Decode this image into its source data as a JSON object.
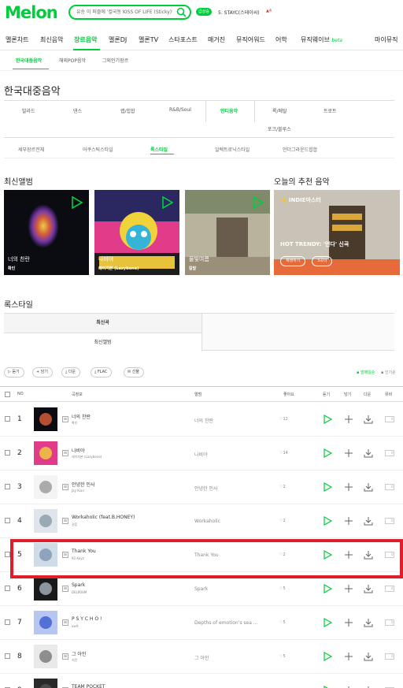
{
  "header": {
    "logo": "Melon",
    "search_text": "유승 이 퍼즐에 '컬국동 KISS OF LIFE (Sticky)'",
    "realtime_badge": "급상승",
    "realtime_text": "5. STAYC(스테이씨)",
    "realtime_change": "▲4"
  },
  "gnb": {
    "items": [
      "멜론차트",
      "최신음악",
      "장르음악",
      "멜론DJ",
      "멜론TV",
      "스타포스트",
      "매거진",
      "뮤직어워드",
      "어학",
      "뮤직웨이브",
      "마이뮤직"
    ],
    "beta": "beta"
  },
  "sub_gnb": [
    "한국대중음악",
    "해외POP음악",
    "그외인기장르"
  ],
  "page_title": "한국대중음악",
  "genres": {
    "row1": [
      "발라드",
      "댄스",
      "랩/힙합",
      "R&B/Soul",
      "인디음악",
      "록/메탈",
      "트로트"
    ],
    "row2": [
      "포크/블루스"
    ]
  },
  "style_tabs": [
    "세부장르전체",
    "어쿠스틱스타일",
    "록스타일",
    "일렉트로닉스타일",
    "언더그라운드힙합"
  ],
  "sections": {
    "new_albums": "최신앨범",
    "recommend": "오늘의 추천 음악",
    "rock_style": "록스타일"
  },
  "albums": [
    {
      "name": "너의 찬란",
      "artist": "확인"
    },
    {
      "name": "나비야",
      "artist": "레이지본 (Lazybone)"
    },
    {
      "name": "물빛여름",
      "artist": "칼말"
    }
  ],
  "recommend": {
    "badge_dj": "DJ",
    "badge_text": "INDIE마스터",
    "title": "HOT TRENDY: '언다' 신곡",
    "btn1": "재생하기",
    "btn2": "3곡더"
  },
  "sub_tabs": [
    "최신곡",
    "최신앨범"
  ],
  "toolbar": {
    "buttons": [
      "듣기",
      "담기",
      "다운",
      "FLAC",
      "선물"
    ],
    "sort_active": "▪ 발매일순",
    "sort_other": "▪ 인기순"
  },
  "table_headers": {
    "no": "NO",
    "song": "곡정보",
    "album": "앨범",
    "like": "좋아요",
    "listen": "듣기",
    "add": "담기",
    "download": "다운",
    "mv": "뮤비"
  },
  "rows": [
    {
      "rank": "1",
      "title": "너의 찬란",
      "artist": "확인",
      "album": "너의 찬란",
      "likes": "12"
    },
    {
      "rank": "2",
      "title": "나비야",
      "artist": "레이지본 (Lazybone)",
      "album": "나비야",
      "likes": "14"
    },
    {
      "rank": "3",
      "title": "안녕한 인사",
      "artist": "Jay Kiair",
      "album": "안녕한 인사",
      "likes": "2"
    },
    {
      "rank": "4",
      "title": "Workaholic (feat.B.HONEY)",
      "artist": "권훈",
      "album": "Workaholic",
      "likes": "2"
    },
    {
      "rank": "5",
      "title": "Thank You",
      "artist": "92.Keyz",
      "album": "Thank You",
      "likes": "2"
    },
    {
      "rank": "6",
      "title": "Spark",
      "artist": "DELIRIUM",
      "album": "Spark",
      "likes": "5"
    },
    {
      "rank": "7",
      "title": "P S Y C H O !",
      "artist": "owlt",
      "album": "Depths of emotion's sea ...",
      "likes": "5"
    },
    {
      "rank": "8",
      "title": "그 아인",
      "artist": "지민",
      "album": "그 아인",
      "likes": "5"
    },
    {
      "rank": "9",
      "title": "TEAM POCKET",
      "artist": "",
      "album": "",
      "likes": ""
    }
  ],
  "mv_count": "0",
  "colors": {
    "accent": "#00cd3c",
    "highlight": "#e01e2b"
  }
}
